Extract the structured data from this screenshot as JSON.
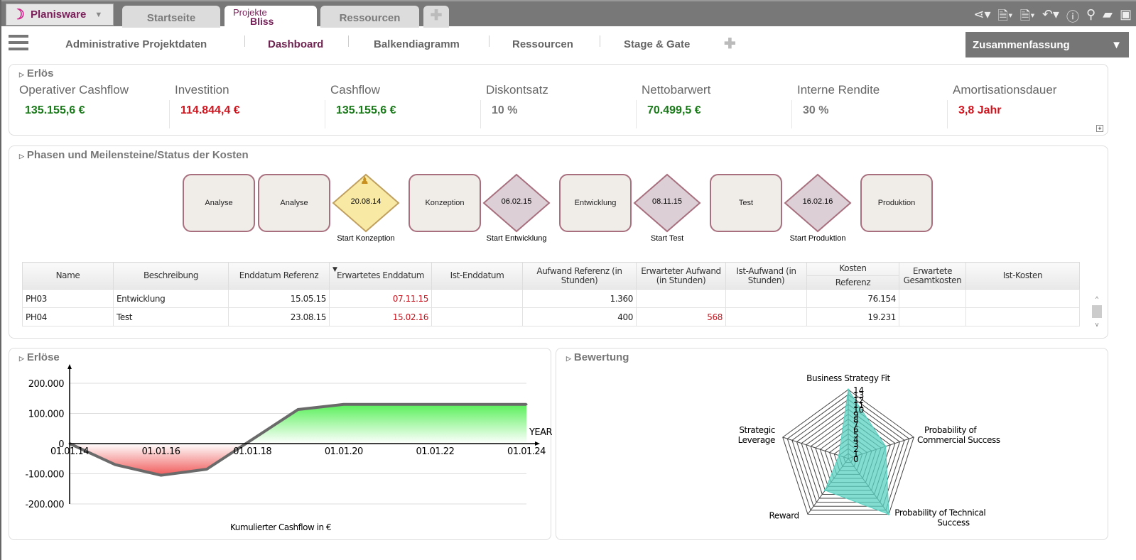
{
  "app": {
    "brand": "Planisware"
  },
  "tabs": [
    {
      "label": "Startseite"
    },
    {
      "label": "Projekte",
      "sub": "Bliss",
      "active": true
    },
    {
      "label": "Ressourcen"
    }
  ],
  "toolbar_icons": [
    "share-icon",
    "pdf-icon",
    "excel-icon",
    "undo-icon",
    "info-icon",
    "search-icon",
    "comment-icon",
    "save-icon"
  ],
  "nav": {
    "items": [
      "Administrative Projektdaten",
      "Dashboard",
      "Balkendiagramm",
      "Ressourcen",
      "Stage & Gate"
    ],
    "active": "Dashboard",
    "summary": "Zusammenfassung"
  },
  "erloes": {
    "title": "Erlös",
    "kpis": [
      {
        "label": "Operativer Cashflow",
        "value": "135.155,6 €",
        "color": "#1a7a1a"
      },
      {
        "label": "Investition",
        "value": "114.844,4 €",
        "color": "#d0141e"
      },
      {
        "label": "Cashflow",
        "value": "135.155,6 €",
        "color": "#1a7a1a"
      },
      {
        "label": "Diskontsatz",
        "value": "10 %",
        "color": "#777777"
      },
      {
        "label": "Nettobarwert",
        "value": "70.499,5 €",
        "color": "#1a7a1a"
      },
      {
        "label": "Interne Rendite",
        "value": "30 %",
        "color": "#777777"
      },
      {
        "label": "Amortisationsdauer",
        "value": "3,8 Jahr",
        "color": "#d0141e"
      }
    ]
  },
  "phases": {
    "title": "Phasen und Meilensteine/Status der Kosten",
    "flow": [
      {
        "type": "phase",
        "label": "Analyse"
      },
      {
        "type": "phase",
        "label": "Analyse"
      },
      {
        "type": "milestone",
        "date": "20.08.14",
        "label": "Start Konzeption",
        "status": "passed"
      },
      {
        "type": "phase",
        "label": "Konzeption"
      },
      {
        "type": "milestone",
        "date": "06.02.15",
        "label": "Start Entwicklung"
      },
      {
        "type": "phase",
        "label": "Entwicklung"
      },
      {
        "type": "milestone",
        "date": "08.11.15",
        "label": "Start Test"
      },
      {
        "type": "phase",
        "label": "Test"
      },
      {
        "type": "milestone",
        "date": "16.02.16",
        "label": "Start Produktion"
      },
      {
        "type": "phase",
        "label": "Produktion"
      }
    ],
    "columns": [
      "Name",
      "Beschreibung",
      "Enddatum Referenz",
      "Erwartetes Enddatum",
      "Ist-Enddatum",
      "Aufwand Referenz (in Stunden)",
      "Erwarteter Aufwand (in Stunden)",
      "Ist-Aufwand (in Stunden)",
      "Kosten",
      "Referenz",
      "Erwartete Gesamtkosten",
      "Ist-Kosten"
    ],
    "rows": [
      [
        "PH03",
        "Entwicklung",
        "15.05.15",
        "07.11.15",
        "",
        "1.360",
        "",
        "",
        "76.154",
        "",
        ""
      ],
      [
        "PH04",
        "Test",
        "23.08.15",
        "15.02.16",
        "",
        "400",
        "568",
        "",
        "19.231",
        "",
        ""
      ]
    ]
  },
  "cashflow": {
    "title": "Erlöse",
    "chart_data": {
      "type": "area",
      "xlabel": "YEAR",
      "caption": "Kumulierter Cashflow in €",
      "x_ticks": [
        "01.01.14",
        "01.01.16",
        "01.01.18",
        "01.01.20",
        "01.01.22",
        "01.01.24"
      ],
      "y_ticks": [
        "200.000",
        "100.000",
        "0",
        "-100.000",
        "-200.000"
      ],
      "ylim": [
        -200000,
        200000
      ],
      "x": [
        2014,
        2015,
        2016,
        2017,
        2018,
        2019,
        2020,
        2021,
        2022,
        2023,
        2024
      ],
      "values": [
        0,
        -70000,
        -105000,
        -85000,
        14000,
        113000,
        130000,
        130000,
        130000,
        130000,
        130000
      ],
      "colors": {
        "positive": "#5af05a",
        "negative": "#f05a5a",
        "line": "#6a6a6a"
      }
    }
  },
  "bewertung": {
    "title": "Bewertung",
    "chart_data": {
      "type": "radar",
      "axes": [
        "Business Strategy Fit",
        "Probability of Commercial Success",
        "Probability of Technical Success",
        "Reward",
        "Strategic Leverage"
      ],
      "values": [
        14,
        8,
        14,
        8,
        2
      ],
      "rmax": 14,
      "ticks": [
        "0",
        "1",
        "2",
        "3",
        "4",
        "5",
        "6",
        "7",
        "8",
        "9",
        "10",
        "11",
        "12",
        "13",
        "14"
      ],
      "color": "#5ad2c2"
    }
  }
}
